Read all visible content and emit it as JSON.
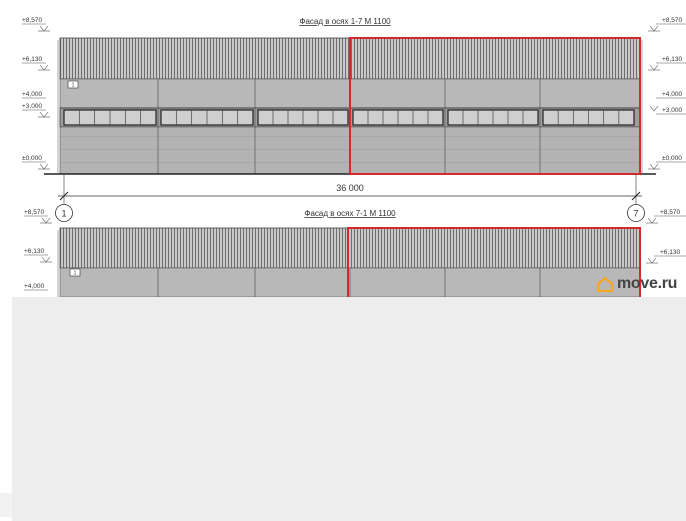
{
  "facade_top": {
    "title": "Фасад в осях 1-7 М 1100",
    "levels_left": [
      "+8,570",
      "+6,130",
      "+4,000",
      "+3,000",
      "±0,000"
    ],
    "levels_right": [
      "+8,570",
      "+6,130",
      "+4,000",
      "+3,000",
      "±0,000"
    ],
    "marker": "1"
  },
  "dimension": {
    "value": "36 000"
  },
  "axes": {
    "left": "1",
    "right": "7"
  },
  "facade_bottom": {
    "title": "Фасад в осях 7-1 М 1100",
    "levels_left": [
      "+8,570",
      "+6,130",
      "+4,000"
    ],
    "levels_right": [
      "+8,570",
      "+6,130"
    ],
    "marker": "1"
  },
  "watermark": {
    "text": "move.ru",
    "icon": "house-icon"
  },
  "colors": {
    "highlight": "#d42a2a",
    "panel": "#b8b8b8",
    "roof": "#9a9a9a",
    "line": "#333333",
    "watermark_accent": "#f5a623"
  }
}
